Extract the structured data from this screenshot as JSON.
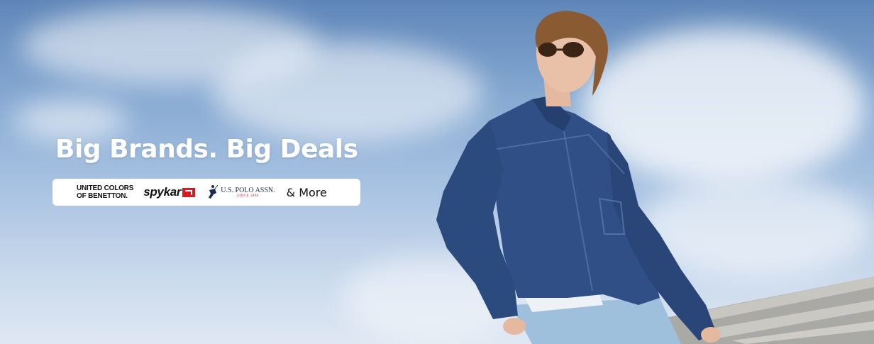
{
  "banner": {
    "headline": "Big Brands. Big Deals",
    "brands": {
      "benetton_line1": "UNITED COLORS",
      "benetton_line2": "OF BENETTON.",
      "spykar": "spykar",
      "polo_line1": "U.S. POLO ASSN.",
      "polo_line2": "SINCE 1890",
      "more": "& More"
    }
  },
  "colors": {
    "sky": "#86a9d2",
    "denim": "#2f4f86",
    "spykar_red": "#d71920"
  }
}
